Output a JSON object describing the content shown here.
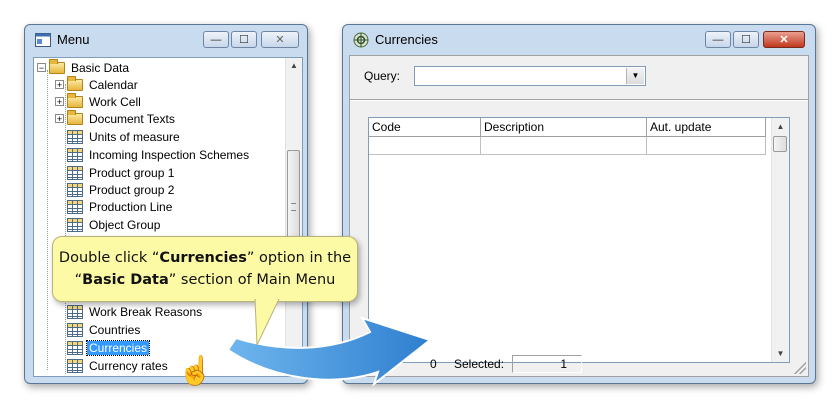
{
  "menu_window": {
    "title": "Menu",
    "controls": {
      "minimize": "—",
      "maximize": "☐",
      "close": "✕"
    },
    "tree": [
      {
        "label": "Basic Data",
        "type": "folder-open",
        "expander": "−"
      },
      {
        "label": "Calendar",
        "type": "folder",
        "expander": "+"
      },
      {
        "label": "Work Cell",
        "type": "folder",
        "expander": "+"
      },
      {
        "label": "Document Texts",
        "type": "folder",
        "expander": "+"
      },
      {
        "label": "Units of measure",
        "type": "table"
      },
      {
        "label": "Incoming Inspection Schemes",
        "type": "table"
      },
      {
        "label": "Product group 1",
        "type": "table"
      },
      {
        "label": "Product group 2",
        "type": "table"
      },
      {
        "label": "Production Line",
        "type": "table"
      },
      {
        "label": "Object Group",
        "type": "table"
      },
      {
        "label": "Work Break Reasons",
        "type": "table"
      },
      {
        "label": "Countries",
        "type": "table"
      },
      {
        "label": "Currencies",
        "type": "table",
        "selected": true
      },
      {
        "label": "Currency rates",
        "type": "table"
      }
    ]
  },
  "currencies_window": {
    "title": "Currencies",
    "controls": {
      "minimize": "—",
      "maximize": "☐",
      "close": "✕"
    },
    "query_label": "Query:",
    "query_value": "",
    "grid": {
      "columns": [
        "Code",
        "Description",
        "Aut. update"
      ]
    },
    "status": {
      "count": "0",
      "selected_label": "Selected:",
      "selected_value": "1"
    }
  },
  "callout": {
    "line1_pre": "Double click “",
    "line1_bold": "Currencies",
    "line1_post": "” option in the",
    "line2_pre": "“",
    "line2_bold": "Basic Data",
    "line2_post": "” section of Main Menu"
  },
  "colors": {
    "window_frame": "#c9dbef",
    "selection": "#3399ff",
    "callout_bg": "#fdfaa6",
    "arrow_blue": "#3a8fd8"
  },
  "icons": [
    "menu-window-icon",
    "currencies-window-icon",
    "folder-icon",
    "table-icon",
    "hand-cursor-icon",
    "arrow-icon"
  ]
}
